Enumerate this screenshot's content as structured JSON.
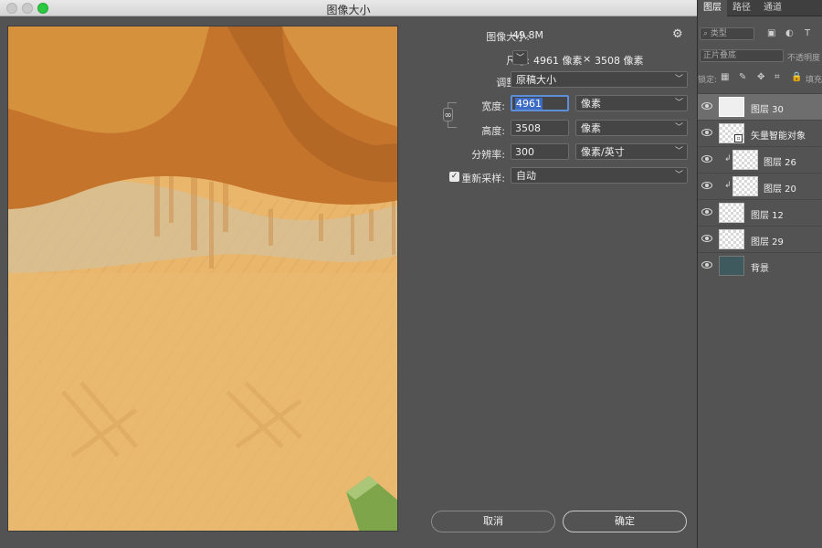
{
  "window": {
    "title": "图像大小"
  },
  "image_size": {
    "size_label": "图像大小:",
    "size_value": "49.8M",
    "dims_label": "尺寸:",
    "dims_width": "4961 像素",
    "dims_sep": "×",
    "dims_height": "3508 像素",
    "fit_label": "调整为:",
    "fit_value": "原稿大小",
    "width_label": "宽度:",
    "width_value": "4961",
    "width_unit": "像素",
    "height_label": "高度:",
    "height_value": "3508",
    "height_unit": "像素",
    "resolution_label": "分辨率:",
    "resolution_value": "300",
    "resolution_unit": "像素/英寸",
    "resample_label": "重新采样:",
    "resample_checked": true,
    "resample_value": "自动"
  },
  "buttons": {
    "cancel": "取消",
    "ok": "确定"
  },
  "layers_panel": {
    "tabs": [
      "图层",
      "路径",
      "通道"
    ],
    "filter_kind": "类型",
    "blend_mode": "正片叠底",
    "opacity_label": "不透明度",
    "lock_label": "锁定:",
    "fill_label": "填充",
    "layers": [
      {
        "name": "图层 30",
        "selected": true,
        "thumb": "white"
      },
      {
        "name": "矢量智能对象",
        "selected": false,
        "thumb": "smart"
      },
      {
        "name": "图层 26",
        "selected": false,
        "thumb": "clip",
        "clipped": true
      },
      {
        "name": "图层 20",
        "selected": false,
        "thumb": "clip",
        "clipped": true
      },
      {
        "name": "图层 12",
        "selected": false,
        "thumb": "transparent"
      },
      {
        "name": "图层 29",
        "selected": false,
        "thumb": "transparent"
      },
      {
        "name": "背景",
        "selected": false,
        "thumb": "teal"
      }
    ]
  }
}
